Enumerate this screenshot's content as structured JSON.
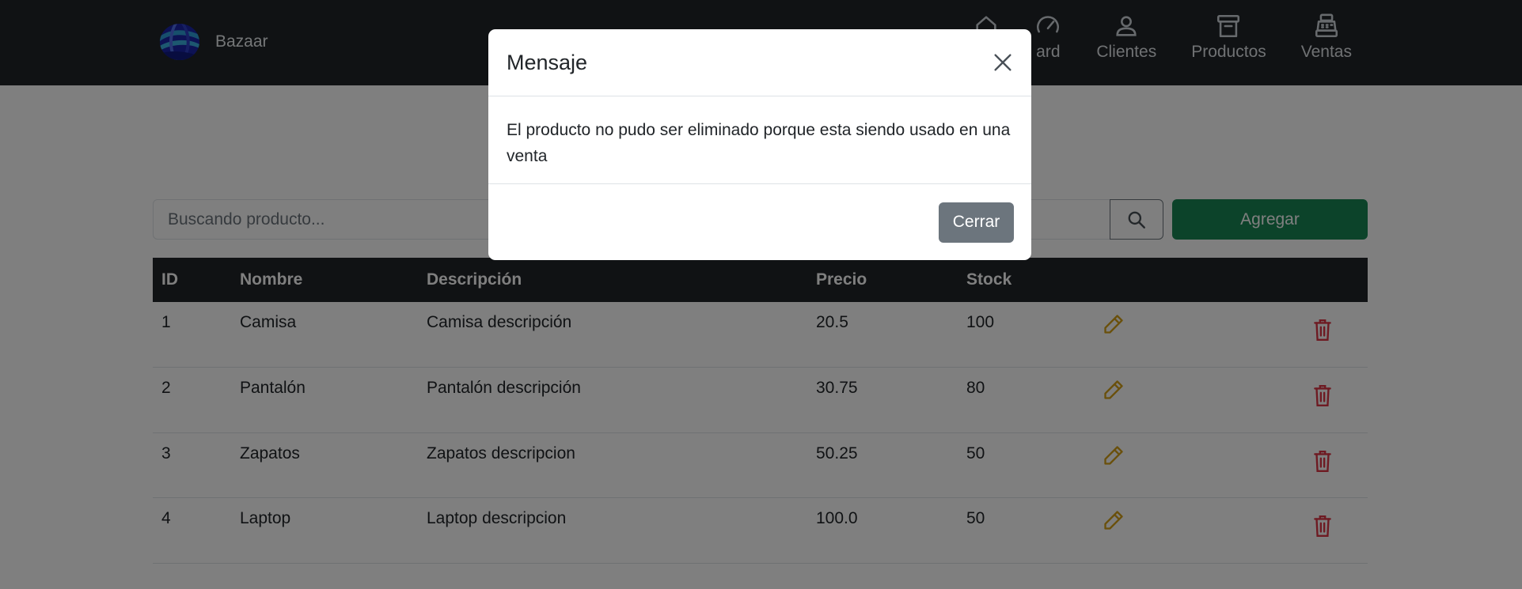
{
  "navbar": {
    "brand": "Bazaar",
    "items": [
      {
        "label": "",
        "icon": "home-icon"
      },
      {
        "label": "ard",
        "icon": "dashboard-icon"
      },
      {
        "label": "Clientes",
        "icon": "person-icon"
      },
      {
        "label": "Productos",
        "icon": "archive-icon"
      },
      {
        "label": "Ventas",
        "icon": "cash-register-icon"
      }
    ]
  },
  "search": {
    "placeholder": "Buscando producto...",
    "button_icon": "search-icon"
  },
  "add_button": "Agregar",
  "table": {
    "headers": [
      "ID",
      "Nombre",
      "Descripción",
      "Precio",
      "Stock",
      "",
      ""
    ],
    "rows": [
      {
        "id": "1",
        "name": "Camisa",
        "description": "Camisa descripción",
        "price": "20.5",
        "stock": "100"
      },
      {
        "id": "2",
        "name": "Pantalón",
        "description": "Pantalón descripción",
        "price": "30.75",
        "stock": "80"
      },
      {
        "id": "3",
        "name": "Zapatos",
        "description": "Zapatos descripcion",
        "price": "50.25",
        "stock": "50"
      },
      {
        "id": "4",
        "name": "Laptop",
        "description": "Laptop descripcion",
        "price": "100.0",
        "stock": "50"
      }
    ],
    "edit_icon": "pencil-icon",
    "delete_icon": "trash-icon"
  },
  "modal": {
    "title": "Mensaje",
    "body": "El producto no pudo ser eliminado porque esta siendo usado en una venta",
    "close_button": "Cerrar",
    "close_icon": "close-icon"
  },
  "colors": {
    "navbar": "#212529",
    "add_button": "#198754",
    "edit_icon": "#ffc107",
    "delete_icon": "#dc3545",
    "close_button": "#6c757d"
  }
}
